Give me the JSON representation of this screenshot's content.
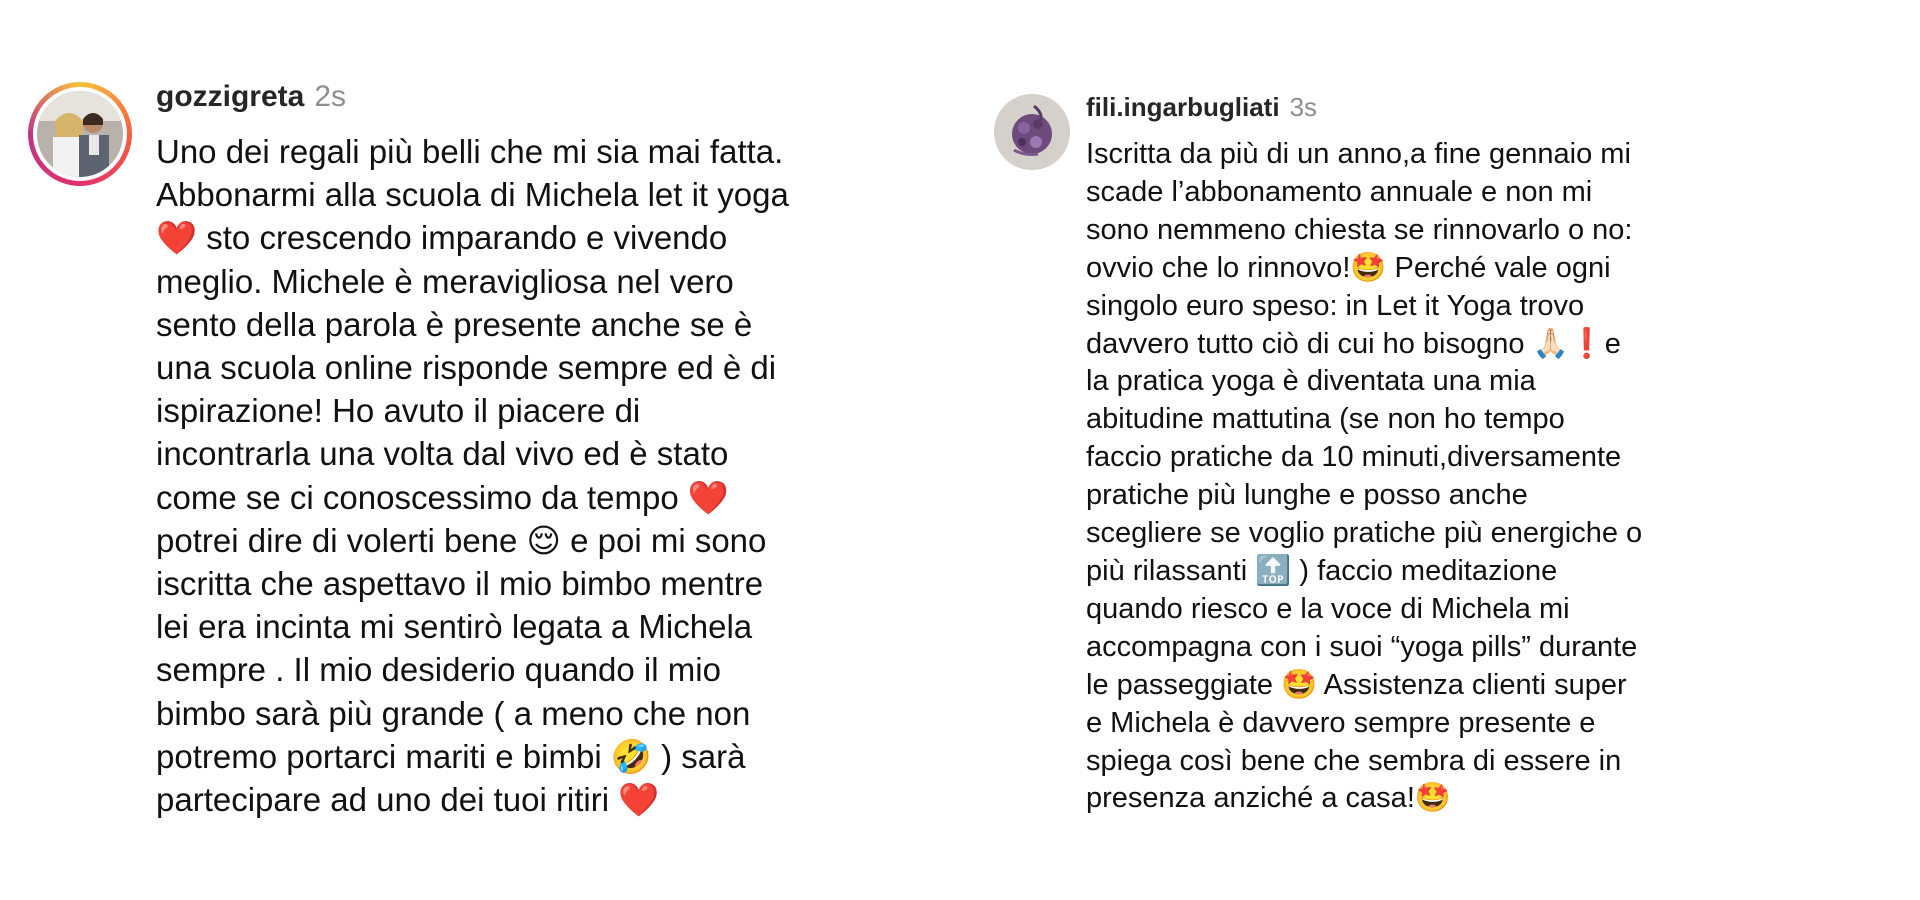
{
  "comments": [
    {
      "username": "gozzigreta",
      "time": "2s",
      "avatar_icon": "profile-photo-couple",
      "lines": [
        "Uno dei regali più belli che mi sia mai fatta.",
        "Abbonarmi alla scuola di Michela let it yoga",
        "❤️ sto crescendo imparando e vivendo",
        "meglio. Michele è meravigliosa nel vero",
        "sento della parola è presente anche se è",
        "una scuola online risponde sempre ed è di",
        "ispirazione! Ho avuto il piacere di",
        "incontrarla una volta dal vivo ed è stato",
        "come se ci conoscessimo da tempo ❤️",
        "potrei dire di volerti bene 😌 e poi mi sono",
        "iscritta che aspettavo il mio bimbo mentre",
        "lei era incinta mi sentirò legata a Michela",
        "sempre . Il mio desiderio quando il mio",
        "bimbo sarà più grande ( a meno che non",
        "potremo portarci mariti e bimbi 🤣 ) sarà",
        "partecipare ad uno dei tuoi ritiri ❤️"
      ]
    },
    {
      "username": "fili.ingarbugliati",
      "time": "3s",
      "avatar_icon": "profile-photo-purple-flowers",
      "lines": [
        "Iscritta da più di un anno,a fine gennaio mi",
        "scade l’abbonamento annuale e non mi",
        "sono nemmeno chiesta se rinnovarlo o no:",
        "ovvio che lo rinnovo!🤩 Perché vale ogni",
        "singolo euro speso: in Let it Yoga trovo",
        "davvero tutto ciò di cui ho bisogno 🙏🏻❗️e",
        "la pratica yoga è diventata una mia",
        "abitudine mattutina (se non ho tempo",
        "faccio pratiche da 10 minuti,diversamente",
        "pratiche più lunghe e posso anche",
        "scegliere se voglio pratiche più energiche o",
        "più rilassanti 🔝 ) faccio meditazione",
        "quando riesco e la voce di Michela mi",
        "accompagna con i suoi “yoga pills” durante",
        "le passeggiate 🤩 Assistenza clienti super",
        "e Michela è davvero sempre presente e",
        "spiega così bene che sembra di essere in",
        "presenza anziché a casa!🤩"
      ]
    }
  ],
  "colors": {
    "username": "#262626",
    "time": "#8e8e8e",
    "text": "#111111",
    "heart": "#e0223a"
  }
}
